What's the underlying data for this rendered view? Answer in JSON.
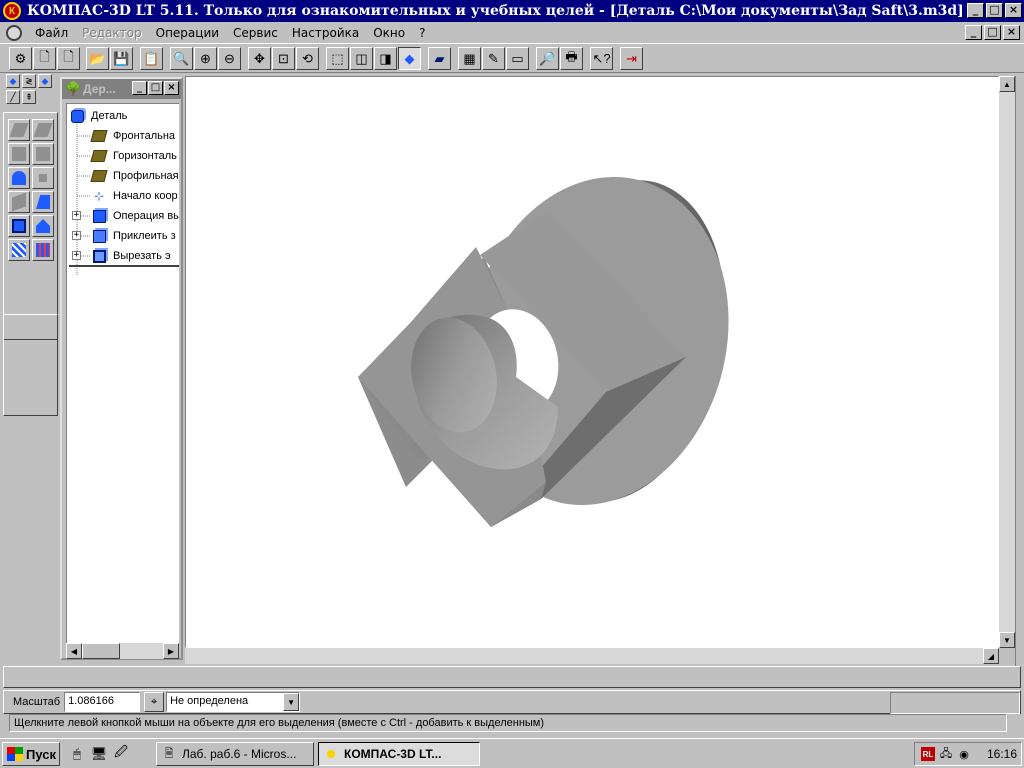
{
  "window": {
    "title": "КОМПАС-3D LT 5.11. Только для ознакомительных и учебных целей - [Деталь C:\\Мои документы\\Зад Saft\\3.m3d]",
    "minimize": "_",
    "maximize": "□",
    "close": "×"
  },
  "menu": {
    "items": [
      {
        "label": "Файл",
        "disabled": false
      },
      {
        "label": "Редактор",
        "disabled": true
      },
      {
        "label": "Операции",
        "disabled": false
      },
      {
        "label": "Сервис",
        "disabled": false
      },
      {
        "label": "Настройка",
        "disabled": false
      },
      {
        "label": "Окно",
        "disabled": false
      },
      {
        "label": "?",
        "disabled": false
      }
    ]
  },
  "tree": {
    "title": "Дер...",
    "root": "Деталь",
    "items": [
      {
        "label": "Фронтальна",
        "icon": "plane-icon"
      },
      {
        "label": "Горизонталь",
        "icon": "plane-icon"
      },
      {
        "label": "Профильная",
        "icon": "plane-icon"
      },
      {
        "label": "Начало коор",
        "icon": "axes-icon"
      },
      {
        "label": "Операция вы",
        "icon": "extrude-icon"
      },
      {
        "label": "Приклеить з",
        "icon": "join-icon"
      },
      {
        "label": "Вырезать э",
        "icon": "cut-icon"
      }
    ]
  },
  "status": {
    "scale_label": "Масштаб",
    "scale_value": "1.086166",
    "snap_value": "Не определена",
    "hint": "Щелкните левой кнопкой мыши на объекте для его выделения (вместе с Ctrl - добавить к выделенным)"
  },
  "taskbar": {
    "start": "Пуск",
    "tasks": [
      {
        "label": "Лаб. раб.6 - Micros...",
        "active": false
      },
      {
        "label": "КОМПАС-3D LT...",
        "active": true
      }
    ],
    "lang": "RL",
    "clock": "16:16"
  },
  "colors": {
    "titlebar": "#000080",
    "face": "#c0c0c0",
    "model_gray": "#9a9a9a"
  }
}
